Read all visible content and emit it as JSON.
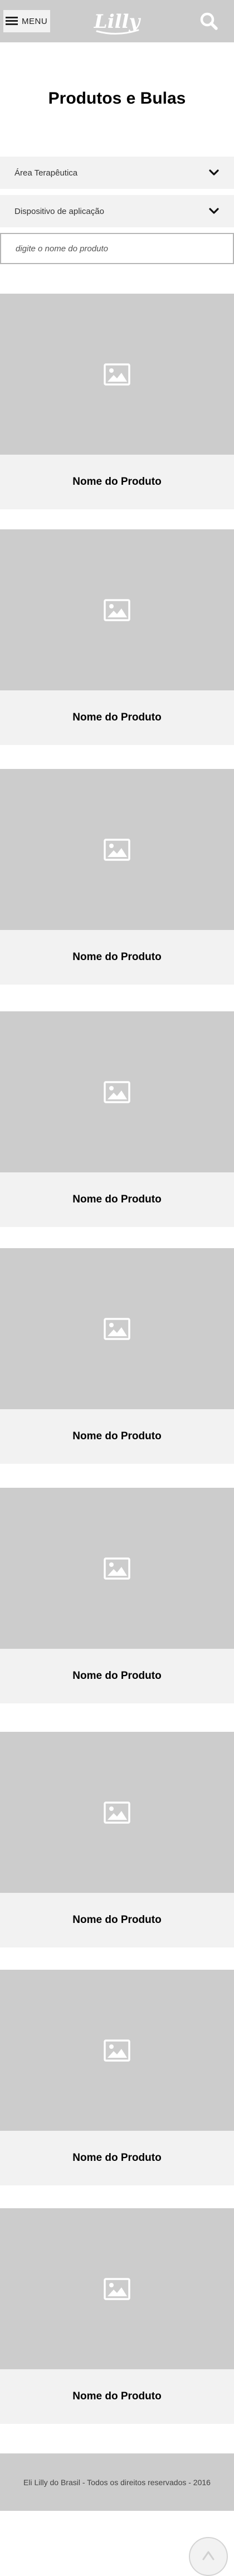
{
  "header": {
    "menu_label": "MENU",
    "logo_text": "Lilly",
    "menu_icon": "hamburger-icon",
    "search_icon": "search-icon"
  },
  "page": {
    "title": "Produtos e Bulas"
  },
  "filters": [
    {
      "label": "Área Terapêutica",
      "icon": "chevron-down-icon"
    },
    {
      "label": "Dispositivo de aplicação",
      "icon": "chevron-down-icon"
    }
  ],
  "search": {
    "placeholder": "digite o nome do produto",
    "value": ""
  },
  "products": [
    {
      "name": "Nome do Produto",
      "image_icon": "image-placeholder-icon"
    },
    {
      "name": "Nome do Produto",
      "image_icon": "image-placeholder-icon"
    },
    {
      "name": "Nome do Produto",
      "image_icon": "image-placeholder-icon"
    },
    {
      "name": "Nome do Produto",
      "image_icon": "image-placeholder-icon"
    },
    {
      "name": "Nome do Produto",
      "image_icon": "image-placeholder-icon"
    },
    {
      "name": "Nome do Produto",
      "image_icon": "image-placeholder-icon"
    },
    {
      "name": "Nome do Produto",
      "image_icon": "image-placeholder-icon"
    },
    {
      "name": "Nome do Produto",
      "image_icon": "image-placeholder-icon"
    },
    {
      "name": "Nome do Produto",
      "image_icon": "image-placeholder-icon"
    }
  ],
  "footer": {
    "text": "Eli Lilly do Brasil - Todos os direitos reservados - 2016"
  },
  "back_to_top": {
    "icon": "caret-up-icon"
  },
  "colors": {
    "header_bg": "#cccccc",
    "panel_bg": "#f2f2f2",
    "image_bg": "#cccccc",
    "text": "#000000"
  }
}
